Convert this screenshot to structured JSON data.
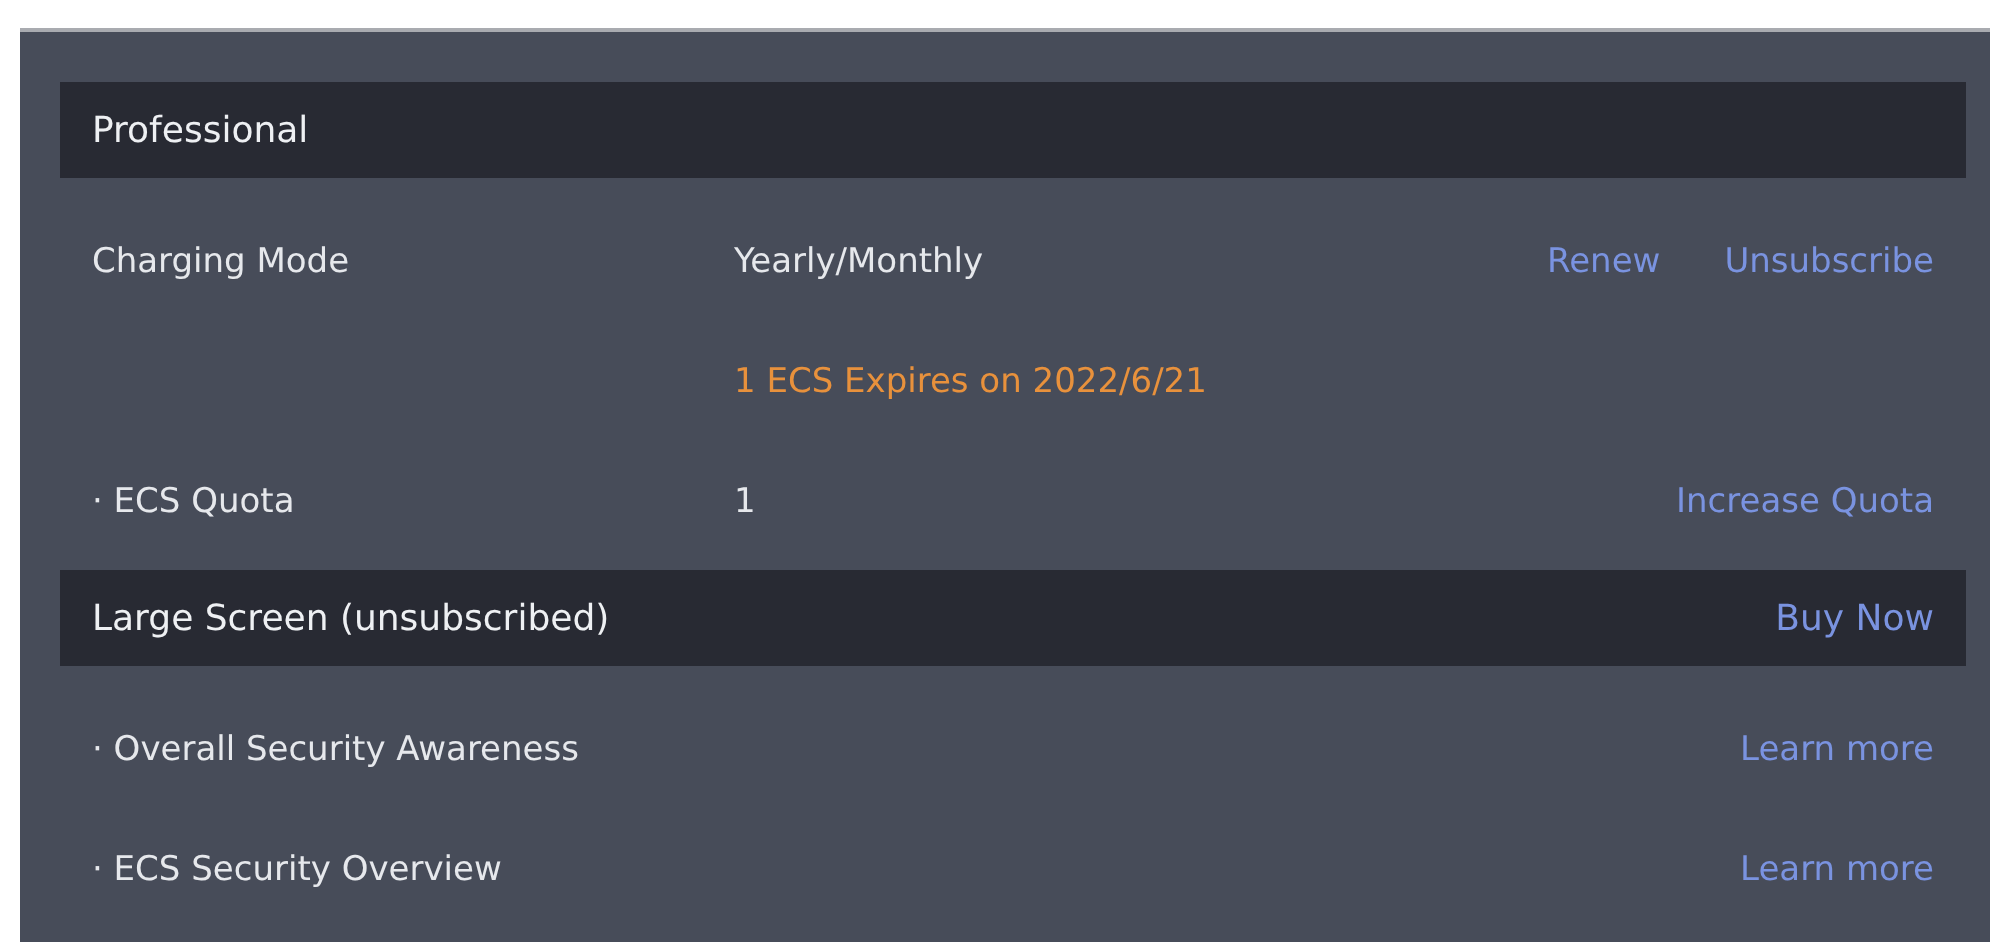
{
  "sections": [
    {
      "title": "Professional",
      "rows": [
        {
          "kind": "normal",
          "label": "Charging Mode",
          "value": "Yearly/Monthly",
          "links": [
            "Renew",
            "Unsubscribe"
          ]
        },
        {
          "kind": "warning",
          "value": "1 ECS Expires on 2022/6/21"
        },
        {
          "kind": "normal",
          "label": "· ECS Quota",
          "value": "1",
          "links": [
            "Increase Quota"
          ]
        }
      ]
    },
    {
      "title": "Large Screen (unsubscribed)",
      "header_link": "Buy Now",
      "rows": [
        {
          "label": "· Overall Security Awareness",
          "links": [
            "Learn more"
          ]
        },
        {
          "label": "· ECS Security Overview",
          "links": [
            "Learn more"
          ]
        }
      ]
    }
  ]
}
